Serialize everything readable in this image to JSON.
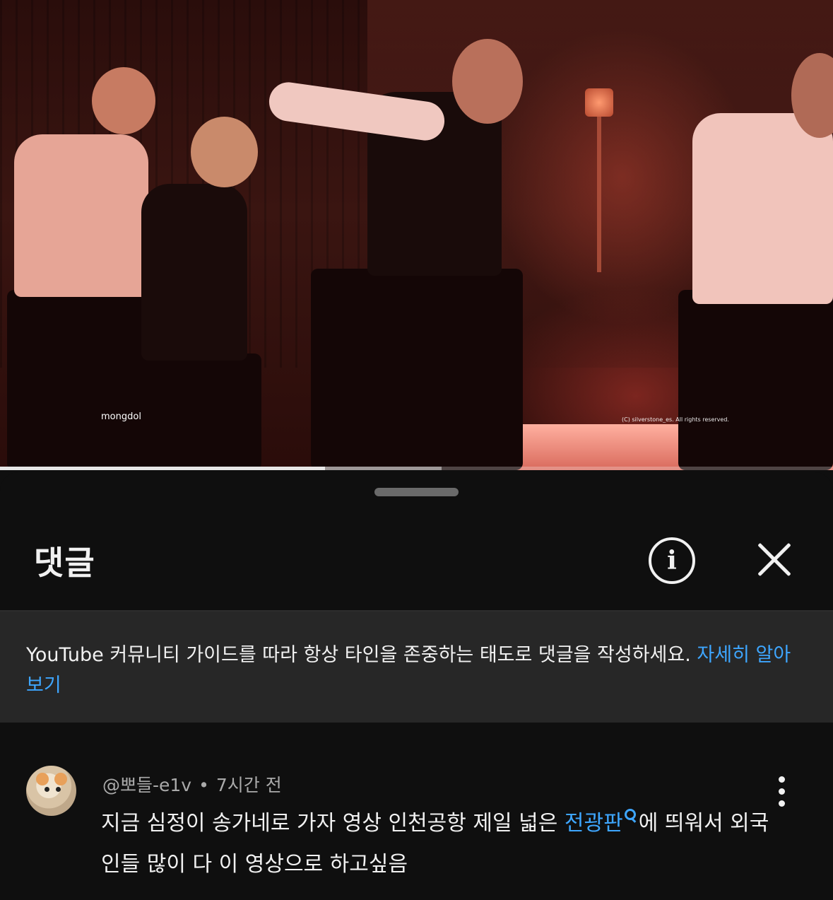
{
  "video": {
    "watermark_left": "mongdol",
    "watermark_right": "(C) silverstone_es. All rights reserved.",
    "progress": {
      "played_fraction": 0.39,
      "buffered_end_fraction": 0.53
    }
  },
  "comments_panel": {
    "title": "댓글",
    "info_icon": "info-icon",
    "close_icon": "close-icon",
    "guideline": {
      "text": "YouTube 커뮤니티 가이드를 따라 항상 타인을 존중하는 태도로 댓글을 작성하세요. ",
      "link": "자세히 알아보기"
    },
    "comments": [
      {
        "author": "@뽀들-e1v",
        "separator": "•",
        "time": "7시간 전",
        "text_before": "지금 심정이 송가네로 가자 영상 인천공항 제일 넓은 ",
        "tag": "전광판",
        "text_after": "에 띄워서 외국인들 많이 다 이 영상으로 하고싶음",
        "menu_icon": "more-vert-icon"
      }
    ]
  },
  "colors": {
    "background": "#0f0f0f",
    "guideline_bg": "#272727",
    "link": "#3ea6ff",
    "secondary_text": "#aaaaaa"
  }
}
